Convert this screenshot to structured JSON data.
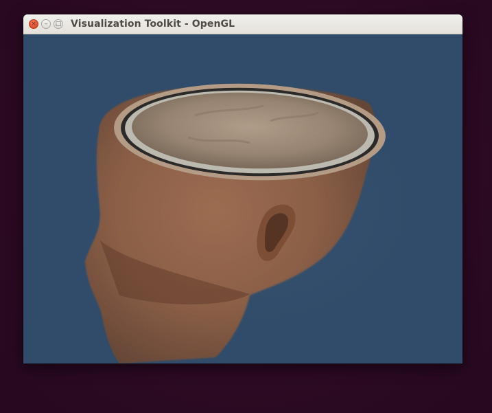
{
  "window": {
    "title": "Visualization Toolkit - OpenGL",
    "controls": {
      "close_icon": "×",
      "minimize_icon": "–",
      "maximize_icon": "□"
    }
  },
  "viewport": {
    "content": "volume-rendered-head",
    "background_color": "#304c6a",
    "skin_color": "#8a5a40",
    "cut_surface_color": "#a89682"
  },
  "desktop": {
    "background_color": "#2c0a23"
  }
}
